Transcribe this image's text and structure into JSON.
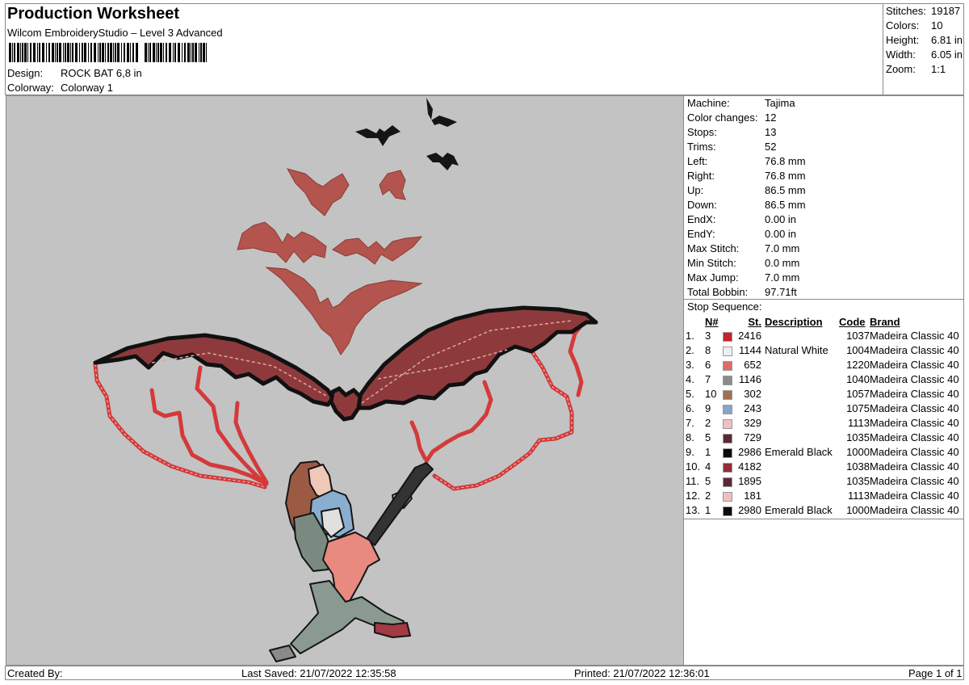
{
  "header": {
    "title": "Production Worksheet",
    "subtitle": "Wilcom EmbroideryStudio – Level 3 Advanced",
    "design_label": "Design:",
    "design_value": "ROCK BAT 6,8 in",
    "colorway_label": "Colorway:",
    "colorway_value": "Colorway 1"
  },
  "summary": [
    {
      "label": "Stitches:",
      "value": "19187"
    },
    {
      "label": "Colors:",
      "value": "10"
    },
    {
      "label": "Height:",
      "value": "6.81 in"
    },
    {
      "label": "Width:",
      "value": "6.05 in"
    },
    {
      "label": "Zoom:",
      "value": "1:1"
    }
  ],
  "info": [
    {
      "label": "Machine:",
      "value": "Tajima"
    },
    {
      "label": "Color changes:",
      "value": "12"
    },
    {
      "label": "Stops:",
      "value": "13"
    },
    {
      "label": "Trims:",
      "value": "52"
    },
    {
      "label": "Left:",
      "value": "76.8 mm"
    },
    {
      "label": "Right:",
      "value": "76.8 mm"
    },
    {
      "label": "Up:",
      "value": "86.5 mm"
    },
    {
      "label": "Down:",
      "value": "86.5 mm"
    },
    {
      "label": "EndX:",
      "value": "0.00 in"
    },
    {
      "label": "EndY:",
      "value": "0.00 in"
    },
    {
      "label": "Max Stitch:",
      "value": "7.0 mm"
    },
    {
      "label": "Min Stitch:",
      "value": "0.0 mm"
    },
    {
      "label": "Max Jump:",
      "value": "7.0 mm"
    },
    {
      "label": "Total Bobbin:",
      "value": "97.71ft"
    }
  ],
  "stops": {
    "title": "Stop Sequence:",
    "headers": {
      "n": "N#",
      "st": "St.",
      "desc": "Description",
      "code": "Code",
      "brand": "Brand"
    },
    "rows": [
      {
        "num": "1.",
        "n": "3",
        "color": "#c8202c",
        "st": "2416",
        "desc": "",
        "code": "1037",
        "brand": "Madeira Classic 40"
      },
      {
        "num": "2.",
        "n": "8",
        "color": "#eeeef2",
        "st": "1144",
        "desc": "Natural White",
        "code": "1004",
        "brand": "Madeira Classic 40"
      },
      {
        "num": "3.",
        "n": "6",
        "color": "#e06a6a",
        "st": "652",
        "desc": "",
        "code": "1220",
        "brand": "Madeira Classic 40"
      },
      {
        "num": "4.",
        "n": "7",
        "color": "#8c8c8c",
        "st": "1146",
        "desc": "",
        "code": "1040",
        "brand": "Madeira Classic 40"
      },
      {
        "num": "5.",
        "n": "10",
        "color": "#a07052",
        "st": "302",
        "desc": "",
        "code": "1057",
        "brand": "Madeira Classic 40"
      },
      {
        "num": "6.",
        "n": "9",
        "color": "#86a6c8",
        "st": "243",
        "desc": "",
        "code": "1075",
        "brand": "Madeira Classic 40"
      },
      {
        "num": "7.",
        "n": "2",
        "color": "#efc0c2",
        "st": "329",
        "desc": "",
        "code": "1113",
        "brand": "Madeira Classic 40"
      },
      {
        "num": "8.",
        "n": "5",
        "color": "#5a2a34",
        "st": "729",
        "desc": "",
        "code": "1035",
        "brand": "Madeira Classic 40"
      },
      {
        "num": "9.",
        "n": "1",
        "color": "#0a0a0a",
        "st": "2986",
        "desc": "Emerald Black",
        "code": "1000",
        "brand": "Madeira Classic 40"
      },
      {
        "num": "10.",
        "n": "4",
        "color": "#962c38",
        "st": "4182",
        "desc": "",
        "code": "1038",
        "brand": "Madeira Classic 40"
      },
      {
        "num": "11.",
        "n": "5",
        "color": "#5a2a34",
        "st": "1895",
        "desc": "",
        "code": "1035",
        "brand": "Madeira Classic 40"
      },
      {
        "num": "12.",
        "n": "2",
        "color": "#efc0c2",
        "st": "181",
        "desc": "",
        "code": "1113",
        "brand": "Madeira Classic 40"
      },
      {
        "num": "13.",
        "n": "1",
        "color": "#0a0a0a",
        "st": "2980",
        "desc": "Emerald Black",
        "code": "1000",
        "brand": "Madeira Classic 40"
      }
    ]
  },
  "footer": {
    "created_by": "Created By:",
    "last_saved": "Last Saved: 21/07/2022 12:35:58",
    "printed": "Printed: 21/07/2022 12:36:01",
    "page": "Page 1 of 1"
  },
  "colors": {
    "canvas_bg": "#c3c3c3",
    "wing": "#8e3a3c",
    "bat_salmon": "#b4544e",
    "lightning": "#d43a3a",
    "outline": "#111111"
  }
}
